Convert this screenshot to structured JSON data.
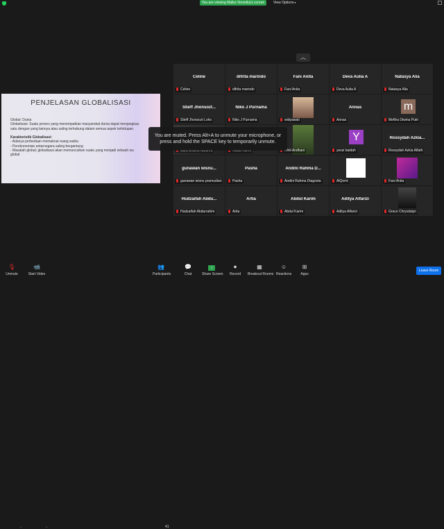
{
  "topbar": {
    "banner": "You are viewing Malko Veronika's screen",
    "view_options": "View Options"
  },
  "shared_screen": {
    "title": "PENJELASAN GLOBALISASI",
    "lines": [
      {
        "text": "Global: Dunia",
        "bold": false
      },
      {
        "text": "Globalisasi: Suatu proses yang menempatkan masyarakat dunia dapat menjangkau",
        "bold": false
      },
      {
        "text": "satu dengan yang lainnya atau saling terhubung dalam semua aspek kehidupan.",
        "bold": false
      },
      {
        "text": "",
        "bold": false
      },
      {
        "text": "Karakteristik Globalisasi:",
        "bold": true
      },
      {
        "text": "- Adanya perbedaan memaknai ruang waktu",
        "bold": false
      },
      {
        "text": "- Perekonomian antarnegara saling bergantung",
        "bold": false
      },
      {
        "text": "- Masalah global; globalisasi akan memunculkan suatu yang menjadi sebuah isu",
        "bold": false
      },
      {
        "text": "global",
        "bold": false
      }
    ]
  },
  "muted_toast": "You are muted. Press Alt+A to unmute your microphone, or press and hold the SPACE key to temporarily unmute.",
  "participants": [
    {
      "name": "Celine",
      "label": "Celine"
    },
    {
      "name": "difrita marindo",
      "label": "difrita marindo"
    },
    {
      "name": "Fani Anita",
      "label": "Fani Anita"
    },
    {
      "name": "Deva Aulia A",
      "label": "Deva Aulia A"
    },
    {
      "name": "Natasya Alia",
      "label": "Natasya Alia"
    },
    {
      "name": "Stieff Jhonsozt...",
      "label": "Stieff Jhonsozt Loho"
    },
    {
      "name": "Niko J Purnama",
      "label": "Niko J Purnama"
    },
    {
      "name": "",
      "label": "widyawati"
    },
    {
      "name": "Annas",
      "label": "Annas"
    },
    {
      "name": "",
      "label": "Meflira Diwina Putri",
      "avatar": "m"
    },
    {
      "name": "",
      "label": "Sara Sharra Azzahra"
    },
    {
      "name": "",
      "label": "Abdul Karim"
    },
    {
      "name": "",
      "label": "Afrili Andhani"
    },
    {
      "name": "",
      "label": "yessi baidah",
      "avatar": "Y"
    },
    {
      "name": "Rossydah Azkia...",
      "label": "Rossydah Azkia Alfath"
    },
    {
      "name": "gunawan wisnu...",
      "label": "gunawan wisnu pramudian"
    },
    {
      "name": "Pasha",
      "label": "Pasha"
    },
    {
      "name": "Andini Rahma D...",
      "label": "Andini Rahma Diagosta"
    },
    {
      "name": "",
      "label": "AlQorni"
    },
    {
      "name": "",
      "label": "Fani Anita"
    },
    {
      "name": "Hudzaifah Abdu...",
      "label": "Hudzaifah Abdurrahim"
    },
    {
      "name": "Artia",
      "label": "Artia"
    },
    {
      "name": "Abdul Karim",
      "label": "Abdul Karim"
    },
    {
      "name": "Aditya Alfarizi",
      "label": "Aditya Alfarizi"
    },
    {
      "name": "",
      "label": "Grace Chrysdalyn"
    }
  ],
  "toolbar": {
    "unmute": "Unmute",
    "start_video": "Start Video",
    "participants": "Participants",
    "participants_count": "41",
    "chat": "Chat",
    "share_screen": "Share Screen",
    "record": "Record",
    "breakout": "Breakout Rooms",
    "reactions": "Reactions",
    "apps": "Apps",
    "leave": "Leave Room"
  }
}
